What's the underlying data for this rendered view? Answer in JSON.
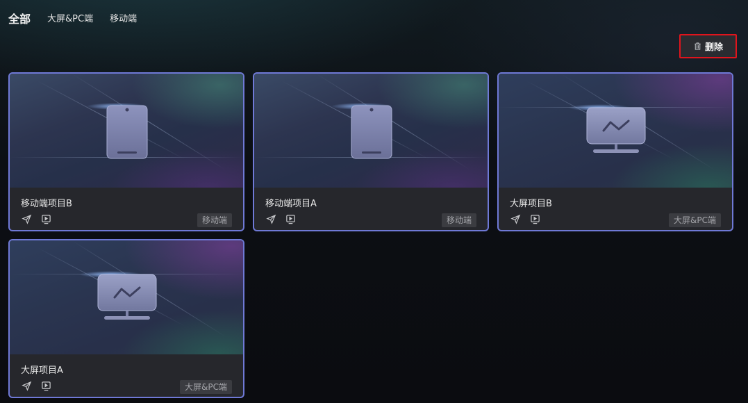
{
  "tabs": [
    {
      "label": "全部",
      "active": true
    },
    {
      "label": "大屏&PC端",
      "active": false
    },
    {
      "label": "移动端",
      "active": false
    }
  ],
  "toolbar": {
    "delete_label": "删除",
    "delete_icon": "trash-icon"
  },
  "cards": [
    {
      "title": "移动端项目B",
      "type": "mobile",
      "badge": "移动端",
      "actions": [
        "send-icon",
        "preview-icon"
      ]
    },
    {
      "title": "移动端项目A",
      "type": "mobile",
      "badge": "移动端",
      "actions": [
        "send-icon",
        "preview-icon"
      ]
    },
    {
      "title": "大屏项目B",
      "type": "screen",
      "badge": "大屏&PC端",
      "actions": [
        "send-icon",
        "preview-icon"
      ]
    },
    {
      "title": "大屏项目A",
      "type": "screen",
      "badge": "大屏&PC端",
      "actions": [
        "send-icon",
        "preview-icon"
      ]
    }
  ],
  "colors": {
    "card_border": "#6f79d6",
    "delete_highlight": "#e0141c",
    "card_body": "#26272c"
  }
}
